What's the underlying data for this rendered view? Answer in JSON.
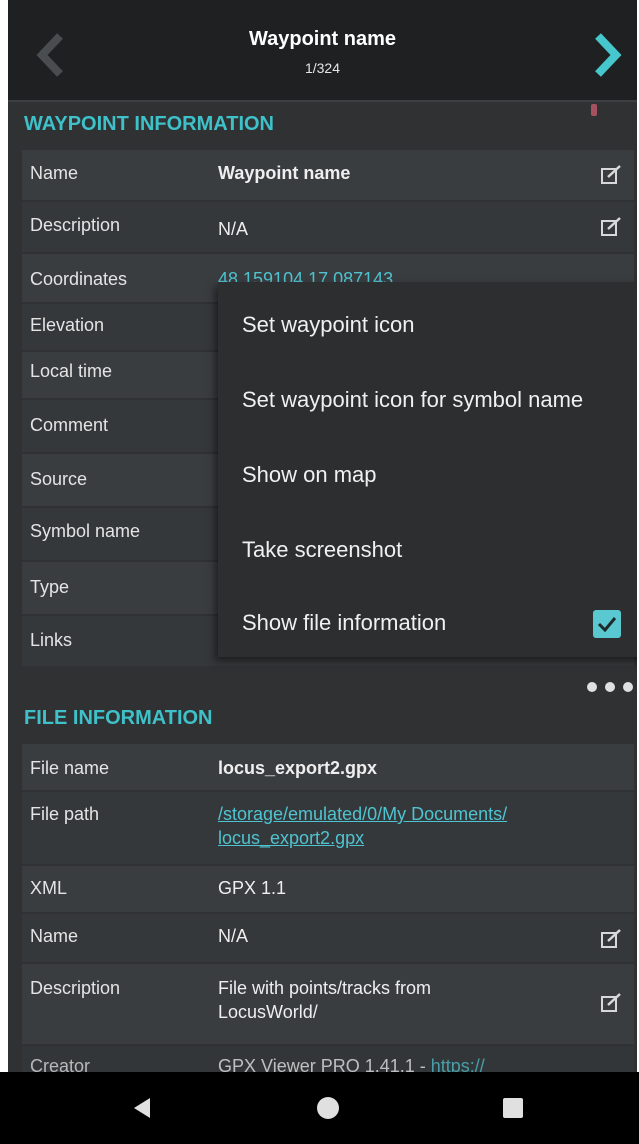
{
  "header": {
    "title": "Waypoint name",
    "subtitle": "1/324",
    "back_icon": "chevron-left-icon",
    "next_icon": "chevron-right-icon"
  },
  "waypoint_section": {
    "title": "WAYPOINT INFORMATION",
    "rows": [
      {
        "label": "Name",
        "value": "Waypoint name"
      },
      {
        "label": "Description",
        "value": "N/A"
      },
      {
        "label": "Coordinates",
        "value": "48.159104 17.087143"
      },
      {
        "label": "Elevation",
        "value": ""
      },
      {
        "label": "Local time",
        "value": ""
      },
      {
        "label": "Comment",
        "value": ""
      },
      {
        "label": "Source",
        "value": ""
      },
      {
        "label": "Symbol name",
        "value": ""
      },
      {
        "label": "Type",
        "value": ""
      },
      {
        "label": "Links",
        "value": ""
      }
    ]
  },
  "context_menu": {
    "items": [
      "Set waypoint icon",
      "Set waypoint icon for symbol name",
      "Show on map",
      "Take screenshot",
      "Show file information"
    ],
    "show_file_information_checked": true
  },
  "file_section": {
    "title": "FILE INFORMATION",
    "rows": [
      {
        "label": "File name",
        "value": "locus_export2.gpx"
      },
      {
        "label": "File path",
        "value_line1": "/storage/emulated/0/My Documents/",
        "value_line2": "locus_export2.gpx"
      },
      {
        "label": "XML",
        "value": "GPX 1.1"
      },
      {
        "label": "Name",
        "value": "N/A"
      },
      {
        "label": "Description",
        "value_line1": "File with points/tracks from",
        "value_line2": "LocusWorld/"
      },
      {
        "label": "Creator",
        "value": "GPX Viewer PRO 1.41.1 - ",
        "value_link": "https://"
      }
    ]
  },
  "colors": {
    "accent": "#3ec1c9",
    "background": "#2f3133",
    "header": "#1f2022"
  },
  "system_nav": {
    "back_icon": "triangle-back-icon",
    "home_icon": "circle-home-icon",
    "recents_icon": "square-recents-icon"
  }
}
